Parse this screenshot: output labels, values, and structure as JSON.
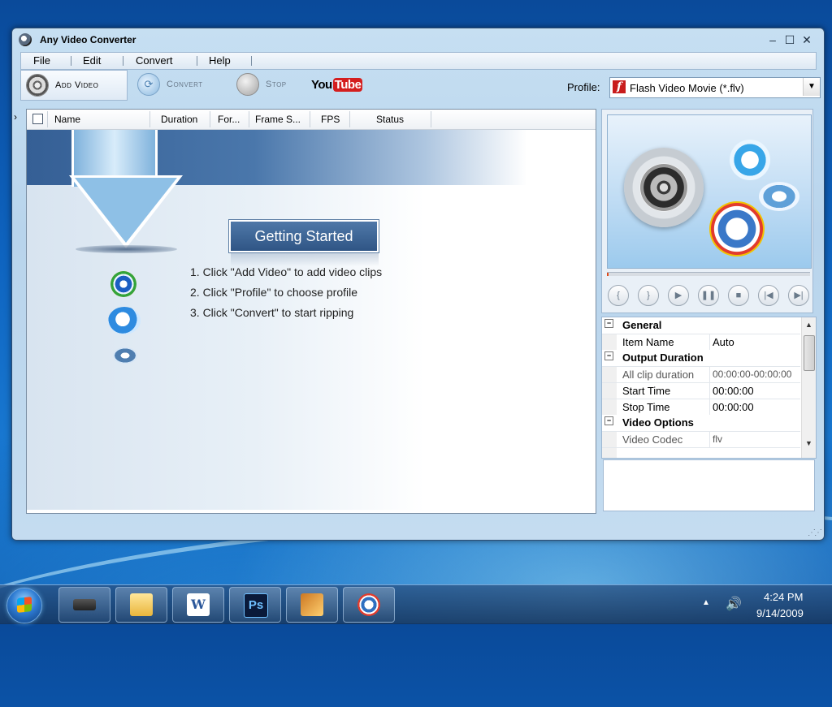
{
  "window": {
    "title": "Any Video Converter",
    "controls": {
      "minimize": "–",
      "maximize": "☐",
      "close": "✕"
    }
  },
  "menu": [
    "File",
    "Edit",
    "Convert",
    "Help"
  ],
  "toolbar": {
    "add_video": "Add Video",
    "convert": "Convert",
    "stop": "Stop",
    "youtube_you": "You",
    "youtube_tube": "Tube",
    "profile_label": "Profile:",
    "profile_value": "Flash Video Movie (*.flv)"
  },
  "file_list": {
    "columns": [
      "Name",
      "Duration",
      "For...",
      "Frame S...",
      "FPS",
      "Status"
    ]
  },
  "getting_started": {
    "title": "Getting Started",
    "steps": [
      "1. Click \"Add Video\" to add video clips",
      "2. Click \"Profile\" to choose profile",
      "3. Click \"Convert\" to start ripping"
    ]
  },
  "properties": {
    "sections": [
      {
        "name": "General",
        "rows": [
          {
            "key": "Item Name",
            "value": "Auto"
          }
        ]
      },
      {
        "name": "Output Duration",
        "rows": [
          {
            "key": "All clip duration",
            "value": "00:00:00-00:00:00"
          },
          {
            "key": "Start Time",
            "value": "00:00:00"
          },
          {
            "key": "Stop Time",
            "value": "00:00:00"
          }
        ]
      },
      {
        "name": "Video Options",
        "rows": [
          {
            "key": "Video Codec",
            "value": "flv"
          }
        ]
      }
    ]
  },
  "taskbar": {
    "time": "4:24 PM",
    "date": "9/14/2009"
  },
  "icons": {
    "player_controls": [
      "set-start-icon",
      "set-end-icon",
      "play-icon",
      "pause-icon",
      "stop-icon",
      "previous-icon",
      "next-icon"
    ]
  }
}
